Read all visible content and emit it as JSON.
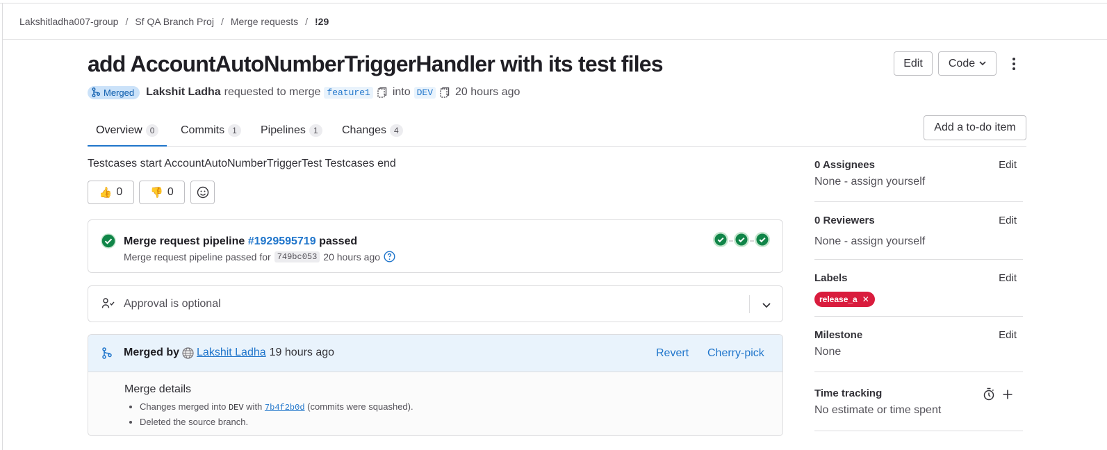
{
  "breadcrumb": {
    "items": [
      "Lakshitladha007-group",
      "Sf QA Branch Proj",
      "Merge requests"
    ],
    "current": "!29",
    "separator": "/"
  },
  "title": "add AccountAutoNumberTriggerHandler with its test files",
  "header_buttons": {
    "edit": "Edit",
    "code": "Code"
  },
  "meta": {
    "status": "Merged",
    "author": "Lakshit Ladha",
    "requested_text": "requested to merge",
    "source_branch": "feature1",
    "into_text": "into",
    "target_branch": "DEV",
    "time": "20 hours ago"
  },
  "tabs": [
    {
      "label": "Overview",
      "count": "0"
    },
    {
      "label": "Commits",
      "count": "1"
    },
    {
      "label": "Pipelines",
      "count": "1"
    },
    {
      "label": "Changes",
      "count": "4"
    }
  ],
  "todo_button": "Add a to-do item",
  "description": "Testcases start AccountAutoNumberTriggerTest Testcases end",
  "reactions": {
    "thumbs_up": {
      "emoji": "👍",
      "count": "0"
    },
    "thumbs_down": {
      "emoji": "👎",
      "count": "0"
    }
  },
  "pipeline": {
    "prefix": "Merge request pipeline",
    "id": "#1929595719",
    "status": "passed",
    "sub_prefix": "Merge request pipeline passed for",
    "sha": "749bc053",
    "time": "20 hours ago"
  },
  "approval": {
    "text": "Approval is optional"
  },
  "merged": {
    "prefix": "Merged by",
    "user": "Lakshit Ladha",
    "time": "19 hours ago",
    "revert": "Revert",
    "cherry_pick": "Cherry-pick",
    "details_title": "Merge details",
    "line1_a": "Changes merged into",
    "line1_branch": "DEV",
    "line1_with": "with",
    "line1_commit": "7b4f2b0d",
    "line1_b": "(commits were squashed).",
    "line2": "Deleted the source branch."
  },
  "sidebar": {
    "assignees": {
      "title": "0 Assignees",
      "edit": "Edit",
      "value": "None - assign yourself"
    },
    "reviewers": {
      "title": "0 Reviewers",
      "edit": "Edit",
      "value": "None - assign yourself"
    },
    "labels": {
      "title": "Labels",
      "edit": "Edit",
      "chip": "release_a",
      "chip_color": "#d91c3d"
    },
    "milestone": {
      "title": "Milestone",
      "edit": "Edit",
      "value": "None"
    },
    "time_tracking": {
      "title": "Time tracking",
      "value": "No estimate or time spent"
    }
  },
  "colors": {
    "link": "#1f75cb",
    "success": "#108548",
    "merged_badge_bg": "#cbe2f9",
    "merge_head_bg": "#e9f3fc"
  }
}
